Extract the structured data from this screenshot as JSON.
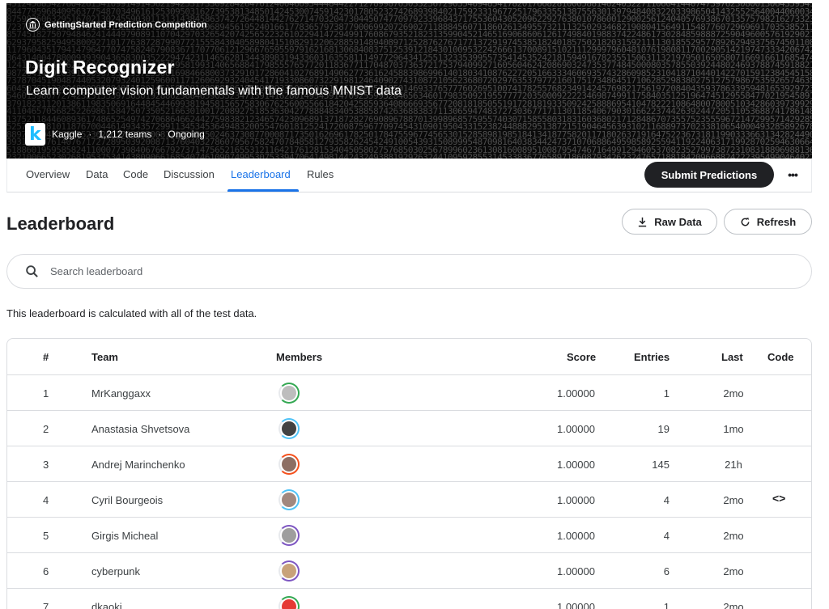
{
  "hero": {
    "category": "GettingStarted Prediction Competition",
    "title": "Digit Recognizer",
    "subtitle": "Learn computer vision fundamentals with the famous MNIST data",
    "host": "Kaggle",
    "teams": "1,212 teams",
    "status": "Ongoing"
  },
  "tabs": [
    "Overview",
    "Data",
    "Code",
    "Discussion",
    "Leaderboard",
    "Rules"
  ],
  "active_tab": "Leaderboard",
  "submit_label": "Submit Predictions",
  "leaderboard": {
    "title": "Leaderboard",
    "raw_data_label": "Raw Data",
    "refresh_label": "Refresh",
    "search_placeholder": "Search leaderboard",
    "note": "This leaderboard is calculated with all of the test data."
  },
  "table": {
    "headers": {
      "rank": "#",
      "team": "Team",
      "members": "Members",
      "score": "Score",
      "entries": "Entries",
      "last": "Last",
      "code": "Code"
    },
    "rows": [
      {
        "rank": "1",
        "team": "MrKanggaxx",
        "score": "1.00000",
        "entries": "1",
        "last": "2mo",
        "ring": "#34a853",
        "face": "#bdbdbd",
        "code": false
      },
      {
        "rank": "2",
        "team": "Anastasia Shvetsova",
        "score": "1.00000",
        "entries": "19",
        "last": "1mo",
        "ring": "#4fc3f7",
        "face": "#424242",
        "code": false
      },
      {
        "rank": "3",
        "team": "Andrej Marinchenko",
        "score": "1.00000",
        "entries": "145",
        "last": "21h",
        "ring": "#f4511e",
        "face": "#8d6e63",
        "code": false
      },
      {
        "rank": "4",
        "team": "Cyril Bourgeois",
        "score": "1.00000",
        "entries": "4",
        "last": "2mo",
        "ring": "#4fc3f7",
        "face": "#a1887f",
        "code": true
      },
      {
        "rank": "5",
        "team": "Girgis Micheal",
        "score": "1.00000",
        "entries": "4",
        "last": "2mo",
        "ring": "#7e57c2",
        "face": "#9e9e9e",
        "code": false
      },
      {
        "rank": "6",
        "team": "cyberpunk",
        "score": "1.00000",
        "entries": "6",
        "last": "2mo",
        "ring": "#7e57c2",
        "face": "#c8a27a",
        "code": false
      },
      {
        "rank": "7",
        "team": "dkaoki",
        "score": "1.00000",
        "entries": "1",
        "last": "2mo",
        "ring": "#34a853",
        "face": "#e53935",
        "code": false
      }
    ]
  },
  "icons": {
    "category": "bank-icon",
    "download": "download-icon",
    "refresh": "refresh-icon",
    "search": "search-icon",
    "more": "more-icon",
    "code": "code-icon"
  }
}
